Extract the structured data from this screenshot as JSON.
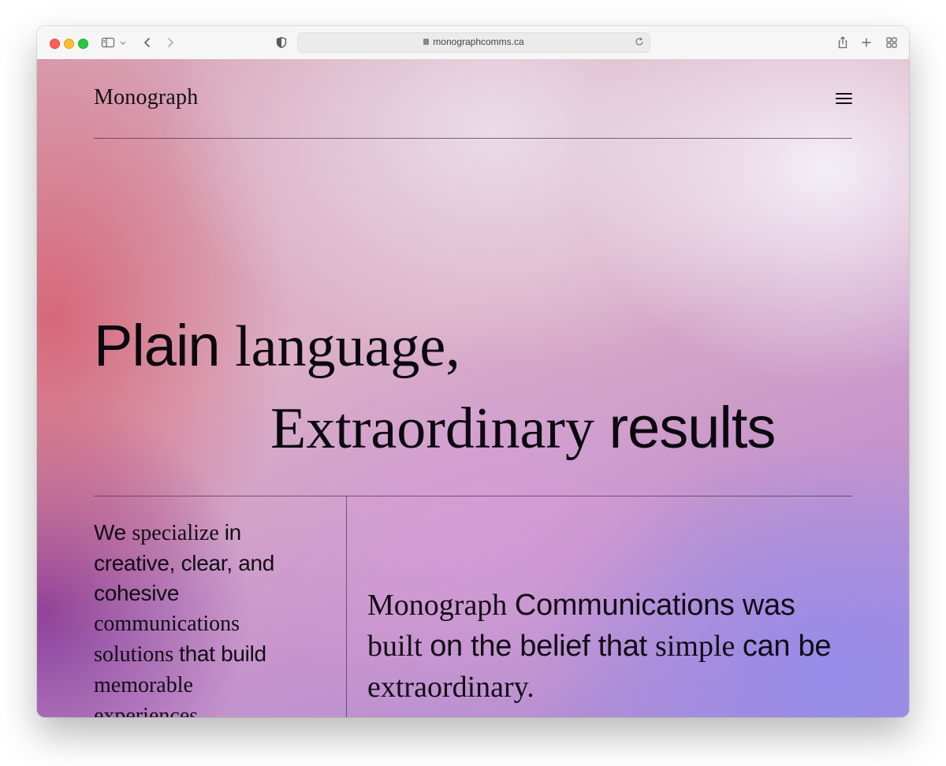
{
  "browser": {
    "url": "monographcomms.ca",
    "icons": [
      "sidebar-icon",
      "chevron-down-icon",
      "back-icon",
      "forward-icon",
      "shield-icon",
      "lock-icon",
      "reload-icon",
      "share-icon",
      "new-tab-icon",
      "tab-overview-icon"
    ]
  },
  "site": {
    "logo": "Monograph",
    "menu_icon": "hamburger-menu-icon"
  },
  "hero": {
    "line1": {
      "part1": "Plain ",
      "part2": "language,"
    },
    "line2": {
      "part1": "Extraordinary ",
      "part2": "results"
    }
  },
  "intro": {
    "p1": "We ",
    "p2": "specialize ",
    "p3": "in creative, clear, and cohesive ",
    "p4": "communications solutions ",
    "p5": "that build ",
    "p6": "memorable experiences."
  },
  "statement": {
    "p1": "Monograph ",
    "p2": "Communications was ",
    "p3": "built ",
    "p4": "on the belief that ",
    "p5": "simple ",
    "p6": "can be ",
    "p7": "extraordinary."
  },
  "colors": {
    "text": "#120c16",
    "rule": "#4a3a4e",
    "gradient_pink": "#d45c6c",
    "gradient_purple": "#7d3096",
    "gradient_lavender": "#948cec"
  }
}
